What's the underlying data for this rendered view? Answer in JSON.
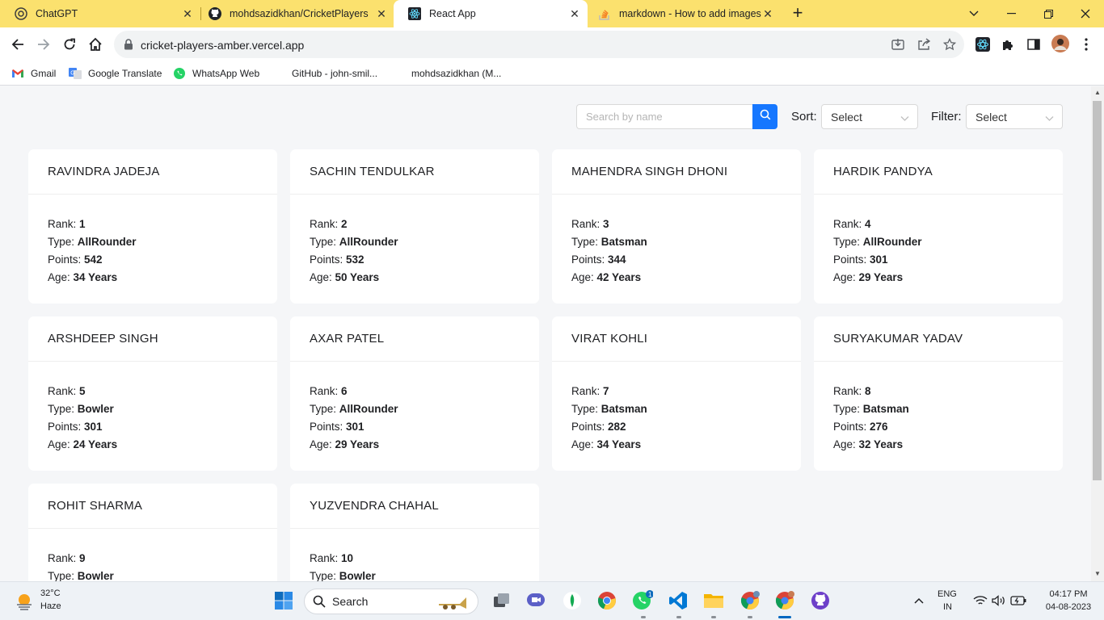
{
  "browser": {
    "tabs": [
      {
        "title": "ChatGPT",
        "icon": "chatgpt-icon"
      },
      {
        "title": "mohdsazidkhan/CricketPlayers",
        "icon": "github-icon"
      },
      {
        "title": "React App",
        "icon": "react-icon",
        "active": true
      },
      {
        "title": "markdown - How to add images",
        "icon": "stackoverflow-icon"
      }
    ],
    "url": "cricket-players-amber.vercel.app",
    "bookmarks": [
      {
        "label": "Gmail",
        "icon": "gmail-icon"
      },
      {
        "label": "Google Translate",
        "icon": "google-translate-icon"
      },
      {
        "label": "WhatsApp Web",
        "icon": "whatsapp-icon"
      },
      {
        "label": "GitHub - john-smil...",
        "icon": "github-icon"
      },
      {
        "label": "mohdsazidkhan (M...",
        "icon": "github-icon"
      }
    ]
  },
  "controls": {
    "search_placeholder": "Search by name",
    "sort_label": "Sort:",
    "sort_value": "Select",
    "filter_label": "Filter:",
    "filter_value": "Select"
  },
  "field_labels": {
    "rank": "Rank: ",
    "type": "Type: ",
    "points": "Points: ",
    "age": "Age: "
  },
  "players": [
    {
      "name": "RAVINDRA JADEJA",
      "rank": "1",
      "type": "AllRounder",
      "points": "542",
      "age": "34 Years"
    },
    {
      "name": "SACHIN TENDULKAR",
      "rank": "2",
      "type": "AllRounder",
      "points": "532",
      "age": "50 Years"
    },
    {
      "name": "MAHENDRA SINGH DHONI",
      "rank": "3",
      "type": "Batsman",
      "points": "344",
      "age": "42 Years"
    },
    {
      "name": "HARDIK PANDYA",
      "rank": "4",
      "type": "AllRounder",
      "points": "301",
      "age": "29 Years"
    },
    {
      "name": "ARSHDEEP SINGH",
      "rank": "5",
      "type": "Bowler",
      "points": "301",
      "age": "24 Years"
    },
    {
      "name": "AXAR PATEL",
      "rank": "6",
      "type": "AllRounder",
      "points": "301",
      "age": "29 Years"
    },
    {
      "name": "VIRAT KOHLI",
      "rank": "7",
      "type": "Batsman",
      "points": "282",
      "age": "34 Years"
    },
    {
      "name": "SURYAKUMAR YADAV",
      "rank": "8",
      "type": "Batsman",
      "points": "276",
      "age": "32 Years"
    },
    {
      "name": "ROHIT SHARMA",
      "rank": "9",
      "type": "Bowler"
    },
    {
      "name": "YUZVENDRA CHAHAL",
      "rank": "10",
      "type": "Bowler"
    }
  ],
  "taskbar": {
    "weather_temp": "32°C",
    "weather_desc": "Haze",
    "search_label": "Search",
    "lang_top": "ENG",
    "lang_bottom": "IN",
    "time": "04:17 PM",
    "date": "04-08-2023",
    "whatsapp_badge": "1"
  },
  "colors": {
    "tabstrip": "#fbe16e",
    "accent": "#1677ff",
    "page_bg": "#f5f6f8"
  }
}
